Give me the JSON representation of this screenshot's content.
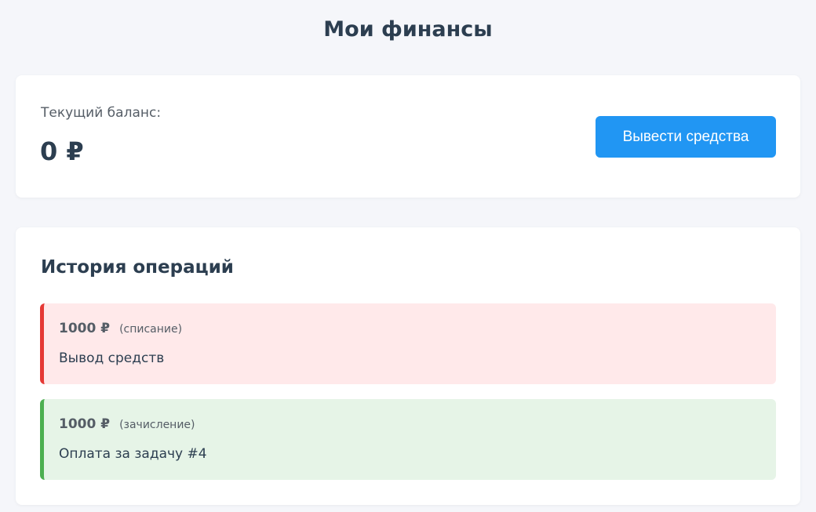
{
  "page": {
    "title": "Мои финансы"
  },
  "balance": {
    "label": "Текущий баланс:",
    "value": "0 ₽",
    "withdraw_label": "Вывести средства"
  },
  "history": {
    "title": "История операций",
    "operations": [
      {
        "amount": "1000 ₽",
        "type": "(списание)",
        "description": "Вывод средств",
        "status_color": "#e53935"
      },
      {
        "amount": "1000 ₽",
        "type": "(зачисление)",
        "description": "Оплата за задачу #4",
        "status_color": "#4caf50"
      }
    ]
  },
  "colors": {
    "accent": "#2196f3",
    "debit_bg": "#ffe9ea",
    "credit_bg": "#e6f4e7"
  }
}
